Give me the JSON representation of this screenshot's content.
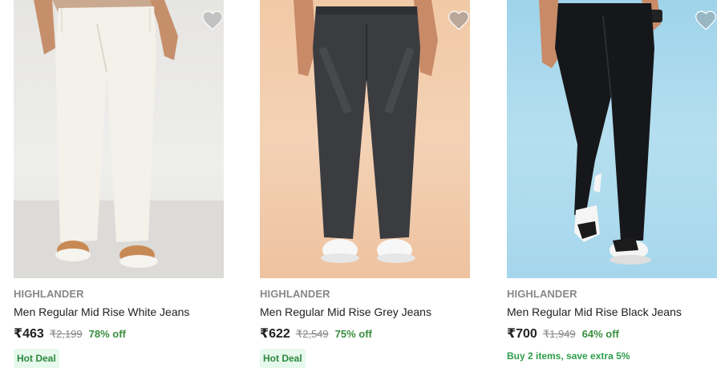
{
  "products": [
    {
      "brand": "HIGHLANDER",
      "title": "Men Regular Mid Rise White Jeans",
      "price": "₹463",
      "mrp": "₹2,199",
      "discount": "78% off",
      "badge": "Hot Deal",
      "jeans_color": "#f2efe9",
      "background_color": "#ebeae7"
    },
    {
      "brand": "HIGHLANDER",
      "title": "Men Regular Mid Rise Grey Jeans",
      "price": "₹622",
      "mrp": "₹2,549",
      "discount": "75% off",
      "badge": "Hot Deal",
      "jeans_color": "#3a3b3f",
      "background_color": "#f2cbab"
    },
    {
      "brand": "HIGHLANDER",
      "title": "Men Regular Mid Rise Black Jeans",
      "price": "₹700",
      "mrp": "₹1,949",
      "discount": "64% off",
      "offer": "Buy 2 items, save extra 5%",
      "jeans_color": "#141518",
      "background_color": "#aedaee"
    }
  ],
  "icons": {
    "wishlist": "heart-icon"
  },
  "colors": {
    "discount_green": "#388e3c",
    "muted_grey": "#878787",
    "badge_bg": "#e7f8ec"
  }
}
